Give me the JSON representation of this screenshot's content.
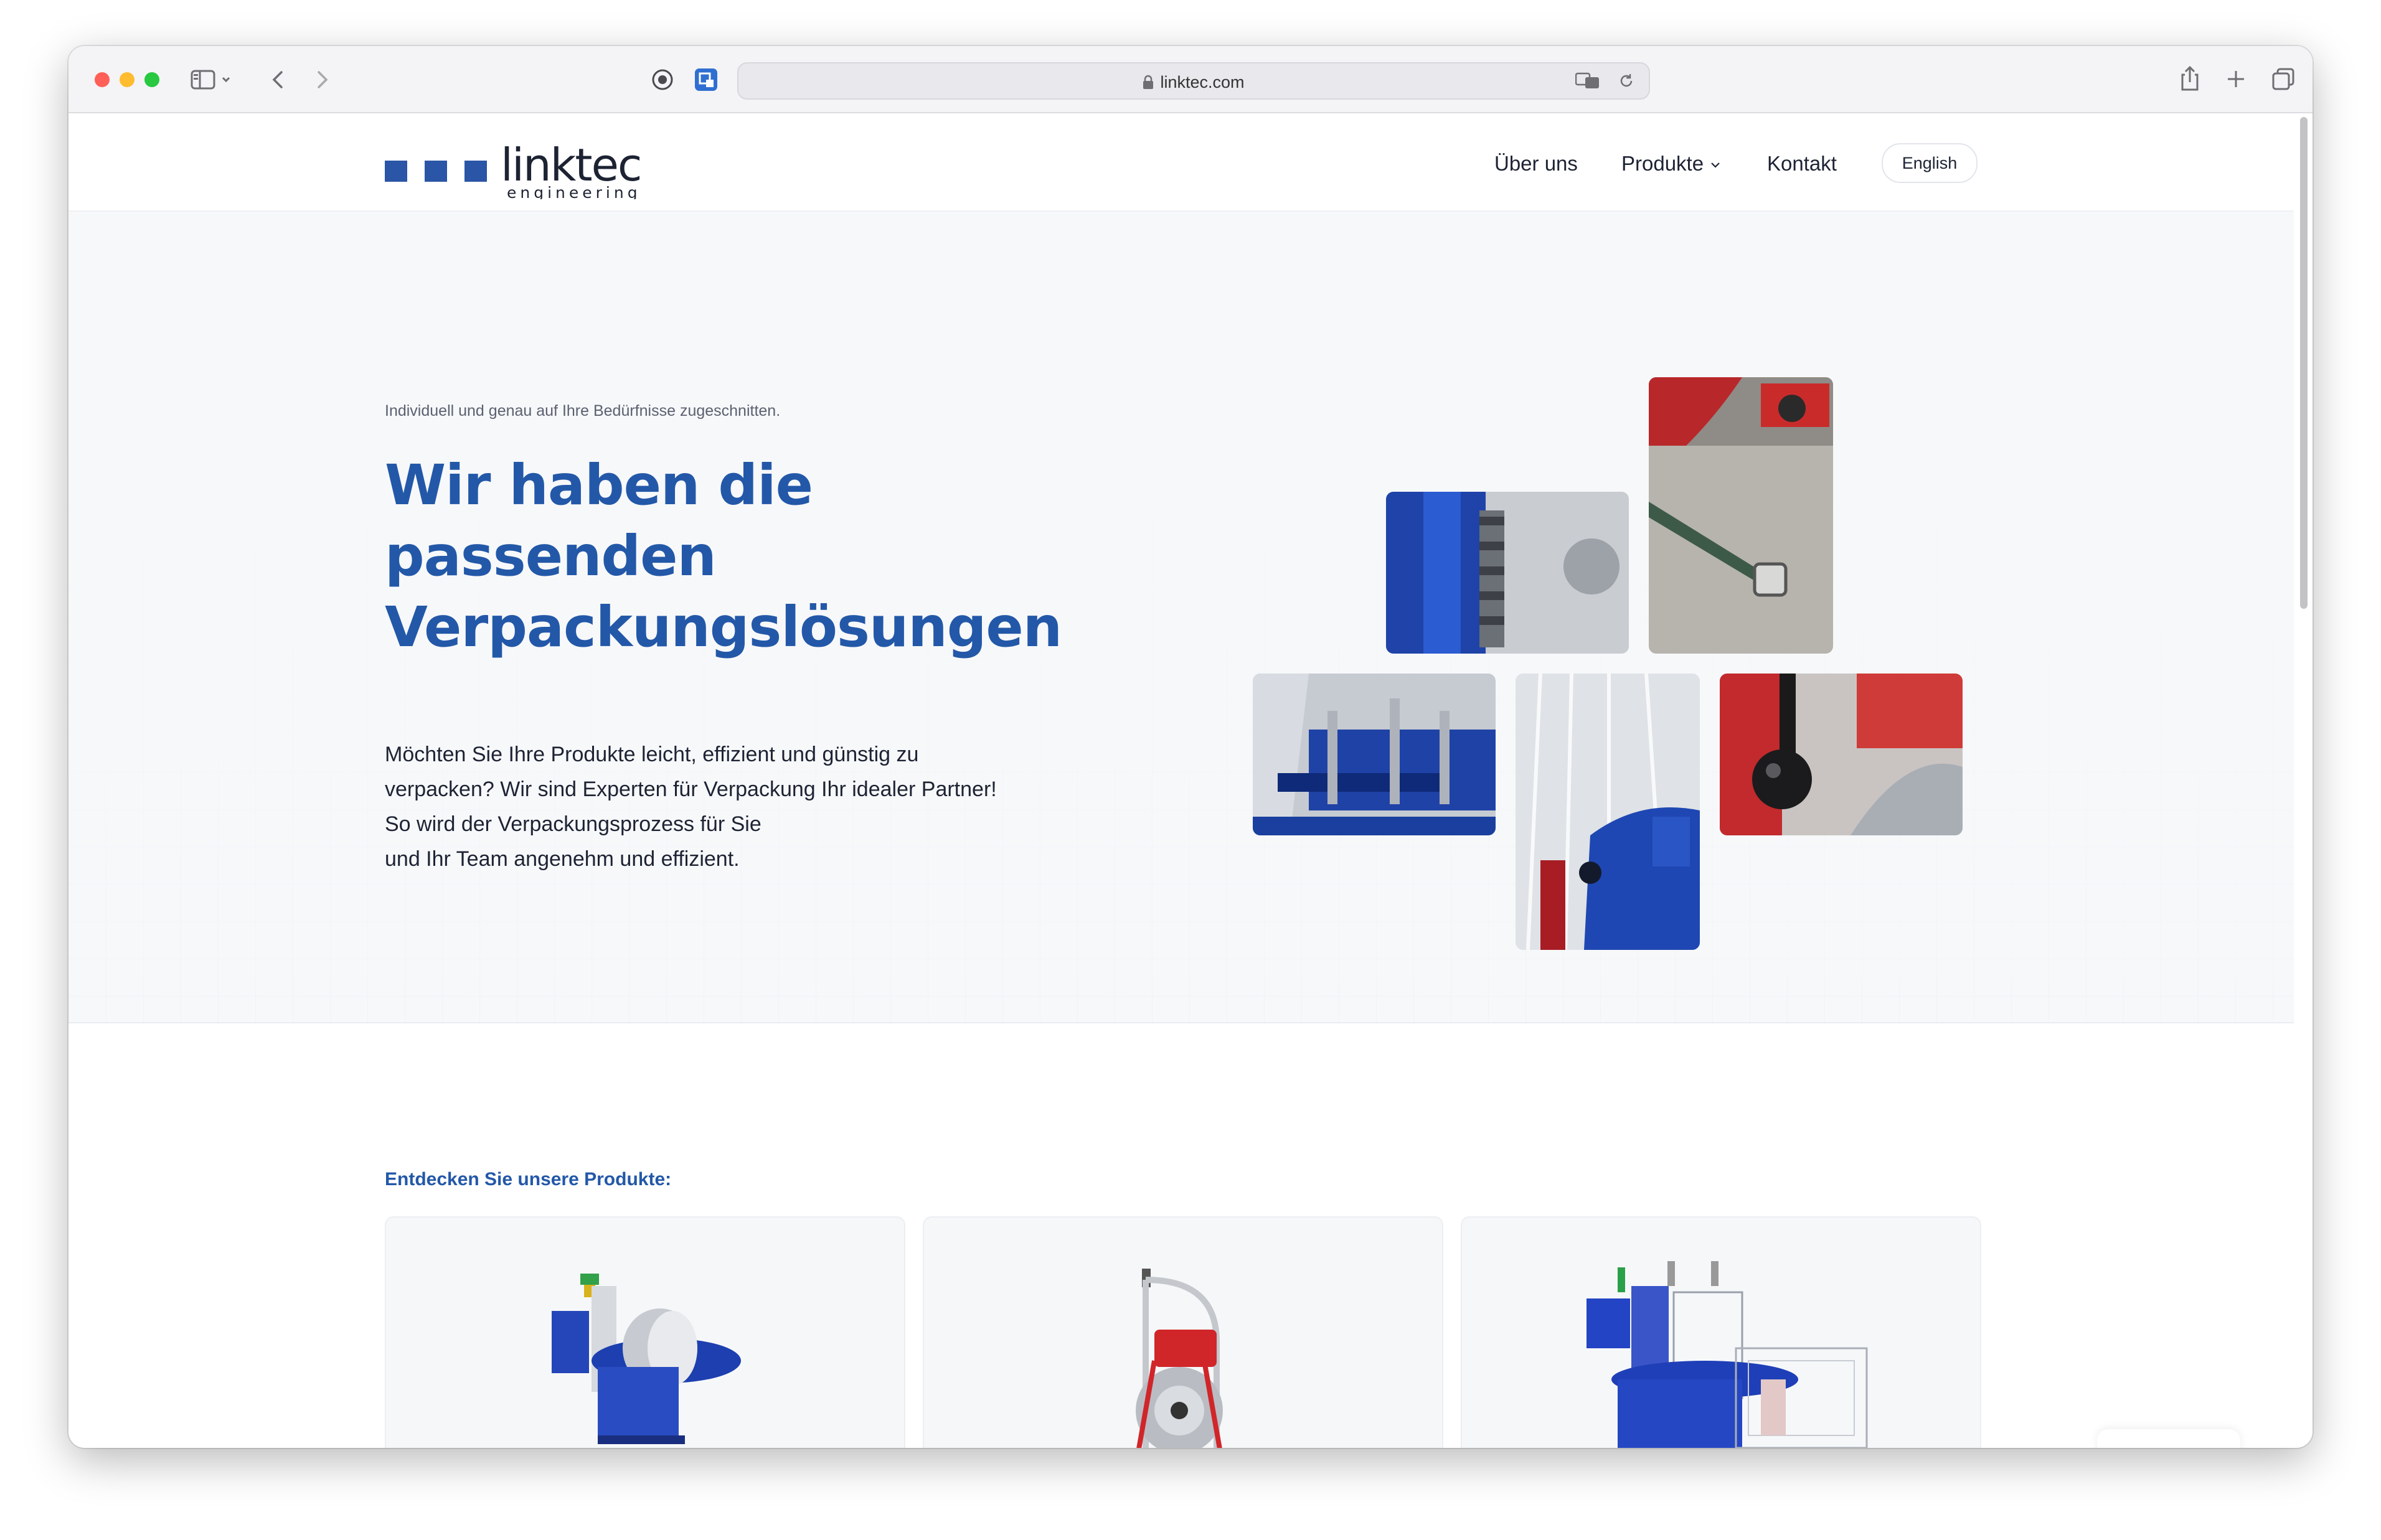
{
  "browser": {
    "url": "linktec.com",
    "icons": {
      "sidebar": "sidebar-toggle-icon",
      "back": "chevron-left-icon",
      "forward": "chevron-right-icon",
      "privacy": "shield-icon",
      "extension": "extension-icon",
      "lock": "lock-icon",
      "translate": "translate-icon",
      "reload": "reload-icon",
      "share": "share-icon",
      "new_tab": "plus-icon",
      "tabs": "tab-overview-icon"
    }
  },
  "site": {
    "logo": {
      "name": "linktec",
      "tagline": "engineering"
    },
    "nav": {
      "ueber_uns": "Über uns",
      "produkte": "Produkte",
      "kontakt": "Kontakt",
      "language": "English"
    },
    "colors": {
      "brand": "#2358a8",
      "text": "#1d2333",
      "hero_bg": "#f7f8fa"
    }
  },
  "hero": {
    "eyebrow": "Individuell und genau auf Ihre Bedürfnisse zugeschnitten.",
    "headline": [
      "Wir haben die",
      "passenden",
      "Verpackungslösungen"
    ],
    "lead": [
      "Möchten Sie Ihre Produkte leicht, effizient und günstig zu",
      "verpacken? Wir sind Experten für Verpackung Ihr idealer Partner!",
      "So wird der Verpackungsprozess für Sie",
      "und Ihr Team angenehm und effizient."
    ]
  },
  "products": {
    "section_title": "Entdecken Sie unsere Produkte:"
  }
}
